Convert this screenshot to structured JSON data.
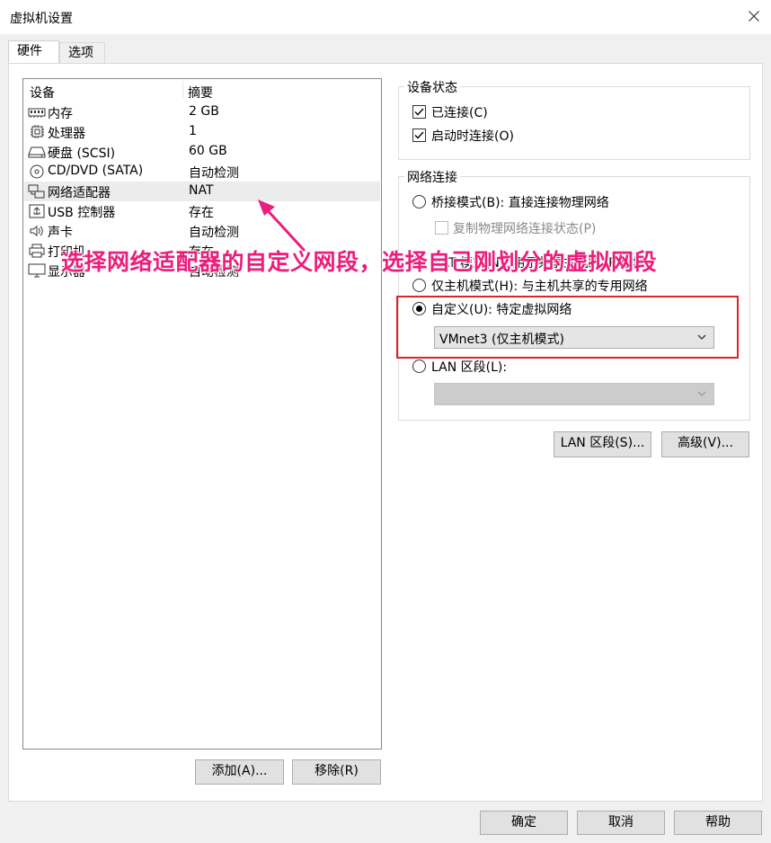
{
  "window": {
    "title": "虚拟机设置"
  },
  "tabs": [
    {
      "label": "硬件",
      "active": true
    },
    {
      "label": "选项",
      "active": false
    }
  ],
  "device_list": {
    "columns": [
      "设备",
      "摘要"
    ],
    "rows": [
      {
        "name": "内存",
        "summary": "2 GB",
        "icon": "memory-icon"
      },
      {
        "name": "处理器",
        "summary": "1",
        "icon": "processor-icon"
      },
      {
        "name": "硬盘 (SCSI)",
        "summary": "60 GB",
        "icon": "hard-disk-icon"
      },
      {
        "name": "CD/DVD (SATA)",
        "summary": "自动检测",
        "icon": "cd-dvd-icon"
      },
      {
        "name": "网络适配器",
        "summary": "NAT",
        "icon": "network-adapter-icon",
        "selected": true
      },
      {
        "name": "USB 控制器",
        "summary": "存在",
        "icon": "usb-icon"
      },
      {
        "name": "声卡",
        "summary": "自动检测",
        "icon": "speaker-icon"
      },
      {
        "name": "打印机",
        "summary": "存在",
        "icon": "printer-icon"
      },
      {
        "name": "显示器",
        "summary": "自动检测",
        "icon": "display-icon"
      }
    ],
    "add_button": "添加(A)...",
    "remove_button": "移除(R)"
  },
  "device_status": {
    "title": "设备状态",
    "connected": {
      "label": "已连接(C)",
      "checked": true
    },
    "connect_at_power_on": {
      "label": "启动时连接(O)",
      "checked": true
    }
  },
  "network_connection": {
    "title": "网络连接",
    "bridged": {
      "label": "桥接模式(B): 直接连接物理网络",
      "checked": false
    },
    "replicate": {
      "label": "复制物理网络连接状态(P)",
      "checked": false
    },
    "nat": {
      "label": "NAT 模式(N): 用于共享主机的 IP 地址",
      "checked": false
    },
    "host_only": {
      "label": "仅主机模式(H): 与主机共享的专用网络",
      "checked": false
    },
    "custom": {
      "label": "自定义(U): 特定虚拟网络",
      "checked": true
    },
    "custom_select_value": "VMnet3 (仅主机模式)",
    "lan_segment": {
      "label": "LAN 区段(L):",
      "checked": false
    },
    "lan_select_value": ""
  },
  "network_buttons": {
    "lan_segments": "LAN 区段(S)...",
    "advanced": "高级(V)..."
  },
  "footer": {
    "ok": "确定",
    "cancel": "取消",
    "help": "帮助"
  },
  "annotation": {
    "text": "选择网络适配器的自定义网段，选择自己刚划分的虚拟网段",
    "color": "#ec1d7b",
    "highlight_color": "#e02424"
  }
}
